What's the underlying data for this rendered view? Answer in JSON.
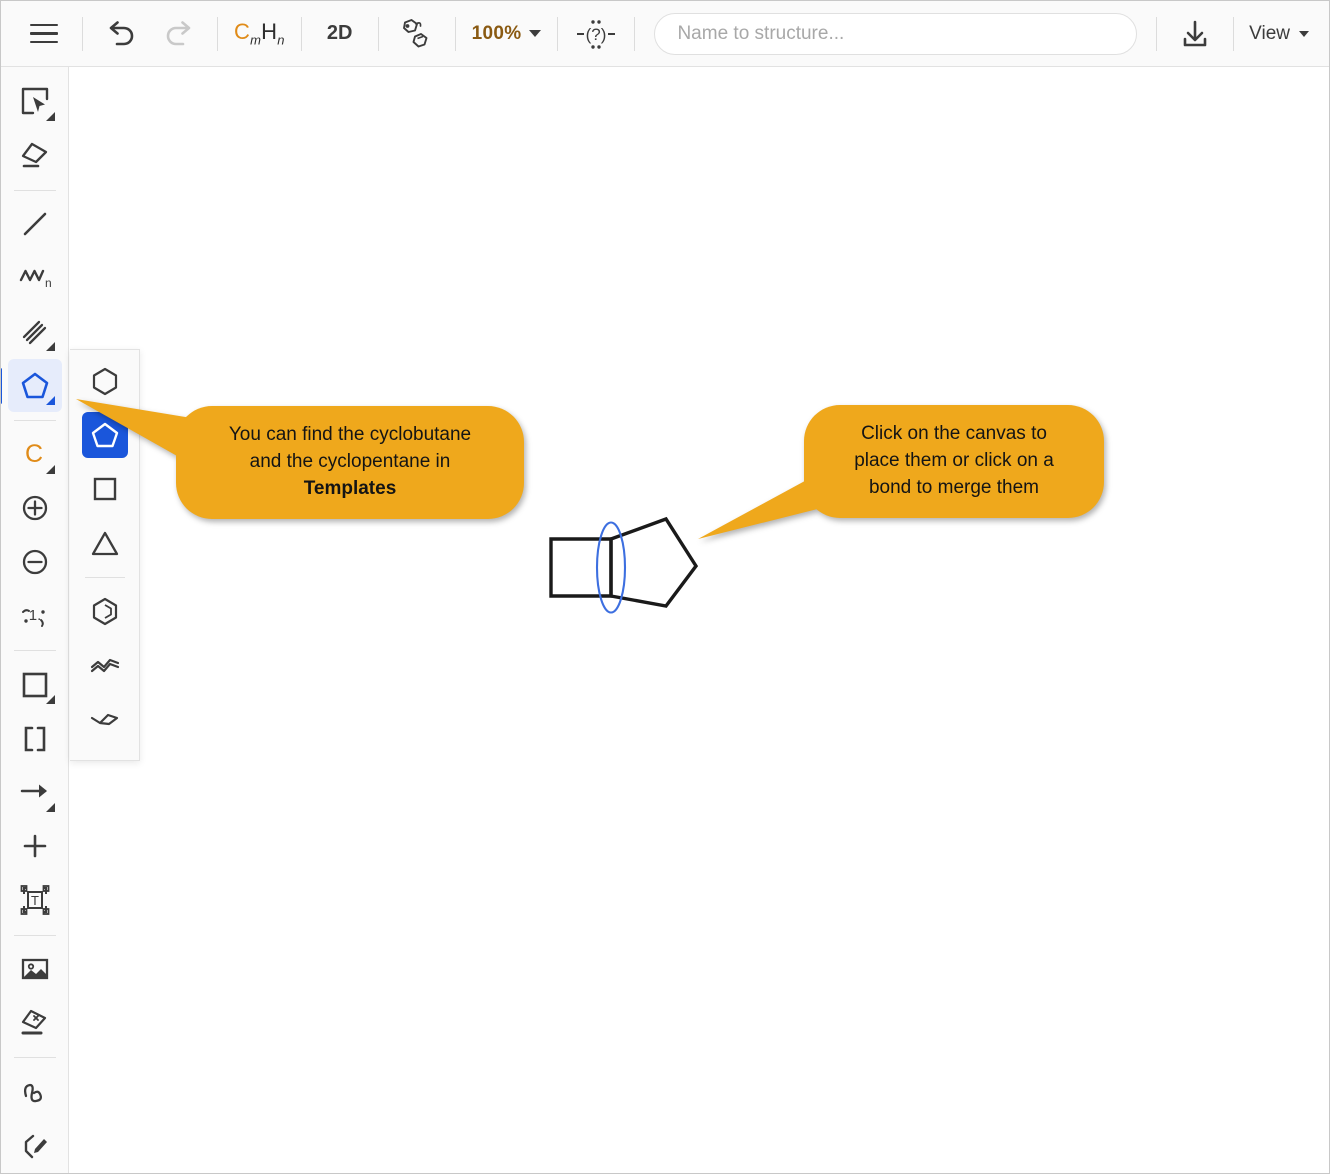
{
  "toolbar": {
    "menu_label": "Menu",
    "undo_label": "Undo",
    "redo_label": "Redo",
    "formula_c": "C",
    "formula_m": "m",
    "formula_h": "H",
    "formula_n": "n",
    "dimension_label": "2D",
    "structure_3d_label": "3D structure",
    "zoom_value": "100%",
    "unknown_atom_label": "-(?)-",
    "search": {
      "placeholder": "Name to structure...",
      "value": ""
    },
    "save_label": "Save",
    "view_label": "View"
  },
  "sidebar": {
    "items": [
      {
        "name": "select-tool",
        "label": "Select"
      },
      {
        "name": "erase-tool",
        "label": "Erase"
      },
      {
        "name": "bond-tool",
        "label": "Single bond"
      },
      {
        "name": "chain-tool",
        "label": "Chain"
      },
      {
        "name": "bond-type-tool",
        "label": "Bond types"
      },
      {
        "name": "templates-tool",
        "label": "Templates"
      },
      {
        "name": "atom-tool",
        "label": "Atom"
      },
      {
        "name": "charge-plus-tool",
        "label": "Increase charge"
      },
      {
        "name": "charge-minus-tool",
        "label": "Decrease charge"
      },
      {
        "name": "atom-number-tool",
        "label": "Atom numbering"
      },
      {
        "name": "shape-tool",
        "label": "Shapes"
      },
      {
        "name": "bracket-tool",
        "label": "Brackets"
      },
      {
        "name": "arrow-tool",
        "label": "Reaction arrow"
      },
      {
        "name": "plus-tool",
        "label": "Reaction plus"
      },
      {
        "name": "text-tool",
        "label": "Text"
      },
      {
        "name": "image-tool",
        "label": "Image"
      },
      {
        "name": "clean-tool",
        "label": "Clean structure"
      },
      {
        "name": "freehand-tool",
        "label": "Freehand"
      },
      {
        "name": "draw-tool",
        "label": "Draw"
      }
    ],
    "active": "templates-tool"
  },
  "templates": {
    "items": [
      {
        "name": "template-cyclohexane",
        "label": "Cyclohexane"
      },
      {
        "name": "template-cyclopentane",
        "label": "Cyclopentane"
      },
      {
        "name": "template-cyclobutane",
        "label": "Cyclobutane"
      },
      {
        "name": "template-cyclopropane",
        "label": "Cyclopropane"
      },
      {
        "name": "template-benzene",
        "label": "Benzene"
      },
      {
        "name": "template-chain-chair",
        "label": "Chair"
      },
      {
        "name": "template-chain-boat",
        "label": "Boat"
      }
    ],
    "selected": "template-cyclopentane"
  },
  "callouts": {
    "templates_hint": {
      "line1": "You can find the cyclobutane",
      "line2": "and the cyclopentane in",
      "line3": "Templates"
    },
    "canvas_hint": {
      "line1": "Click on the canvas to",
      "line2": "place them or click on a",
      "line3": "bond to merge them"
    }
  },
  "molecule": {
    "name": "bicyclo-structure",
    "rings": [
      "cyclobutane",
      "cyclopentane"
    ],
    "highlighted_bond": "shared-fused-bond",
    "bond_color": "#1a1a1a",
    "highlight_color": "#3d6fe0"
  },
  "colors": {
    "callout": "#efa81c",
    "accent_blue": "#1a56db",
    "accent_orange": "#e08b18",
    "toolbar_bg": "#fafafa"
  }
}
